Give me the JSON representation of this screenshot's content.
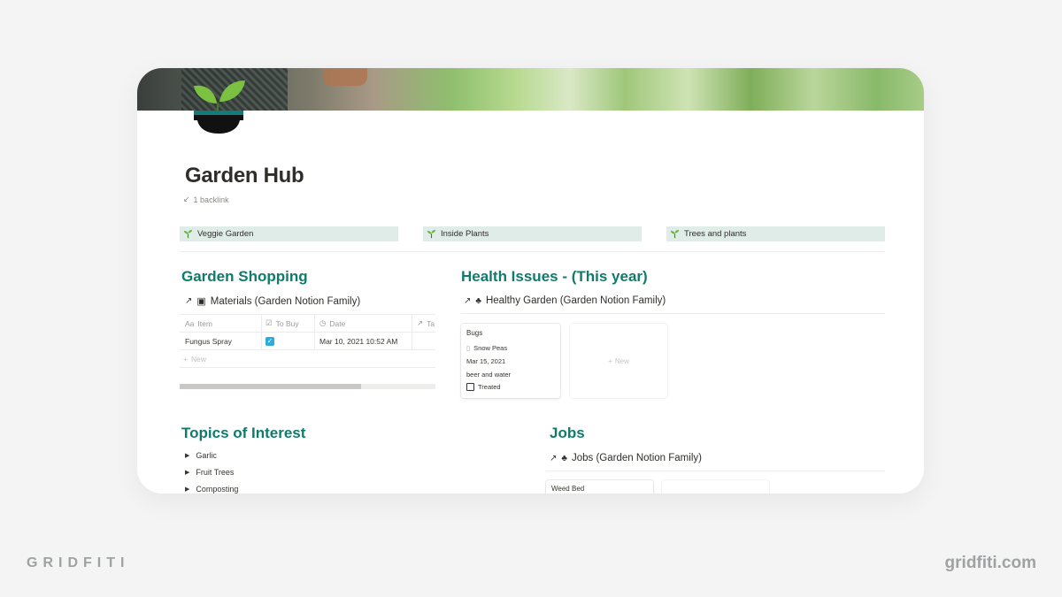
{
  "page": {
    "title": "Garden Hub",
    "backlink": "1 backlink",
    "icon": "bonsai-plant-icon"
  },
  "links": [
    {
      "label": "Veggie Garden",
      "icon": "seedling-icon"
    },
    {
      "label": "Inside Plants",
      "icon": "seedling-icon"
    },
    {
      "label": "Trees and plants",
      "icon": "seedling-icon"
    }
  ],
  "shopping": {
    "heading": "Garden Shopping",
    "db_title": "Materials (Garden Notion Family)",
    "columns": [
      "Item",
      "To Buy",
      "Date",
      "Ta"
    ],
    "rows": [
      {
        "item": "Fungus Spray",
        "to_buy": true,
        "date": "Mar 10, 2021 10:52 AM"
      }
    ],
    "new_label": "New",
    "scroll_fraction": 0.71
  },
  "health": {
    "heading": "Health Issues - (This year)",
    "db_title": "Healthy Garden (Garden Notion Family)",
    "card": {
      "group": "Bugs",
      "plant": "Snow Peas",
      "date": "Mar 15, 2021",
      "remedy": "beer and water",
      "treated_label": "Treated",
      "treated": false
    },
    "new_label": "New"
  },
  "topics": {
    "heading": "Topics of Interest",
    "items": [
      "Garlic",
      "Fruit Trees",
      "Composting"
    ]
  },
  "jobs": {
    "heading": "Jobs",
    "db_title": "Jobs (Garden Notion Family)",
    "card_title": "Weed Bed"
  },
  "brand": {
    "left": "GRIDFITI",
    "right": "gridfiti.com"
  },
  "colors": {
    "heading": "#0f7b6c",
    "link_bg": "#dfece8",
    "checkbox": "#2eaadc",
    "background": "#f4f4f5"
  }
}
